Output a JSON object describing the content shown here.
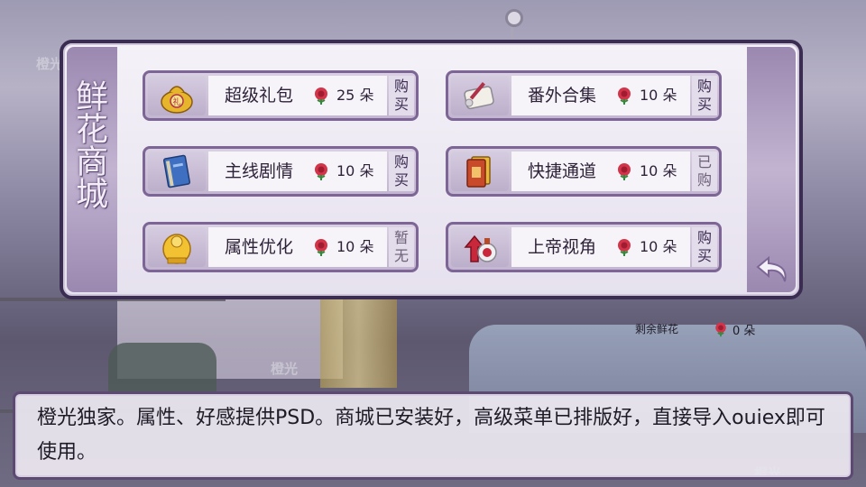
{
  "shop": {
    "title": "鲜花商城",
    "items": [
      {
        "name": "超级礼包",
        "price": "25 朵",
        "action": "购买",
        "icon": "gift-bag-icon"
      },
      {
        "name": "番外合集",
        "price": "10 朵",
        "action": "购买",
        "icon": "scroll-icon"
      },
      {
        "name": "主线剧情",
        "price": "10 朵",
        "action": "购买",
        "icon": "book-icon"
      },
      {
        "name": "快捷通道",
        "price": "10 朵",
        "action": "已购",
        "icon": "card-icon"
      },
      {
        "name": "属性优化",
        "price": "10 朵",
        "action": "暂无",
        "icon": "golden-statue-icon"
      },
      {
        "name": "上帝视角",
        "price": "10 朵",
        "action": "购买",
        "icon": "potion-arrow-icon"
      }
    ],
    "remaining_label": "剩余鲜花",
    "remaining_count": "0 朵",
    "back_icon": "back-arrow-icon"
  },
  "watermark": "橙光",
  "dialog": {
    "text": "橙光独家。属性、好感提供PSD。商城已安装好，高级菜单已排版好，直接导入ouiex即可使用。"
  },
  "colors": {
    "frame": "#3b2c52",
    "item_border": "#7d6695",
    "rose": "#d2344a"
  }
}
